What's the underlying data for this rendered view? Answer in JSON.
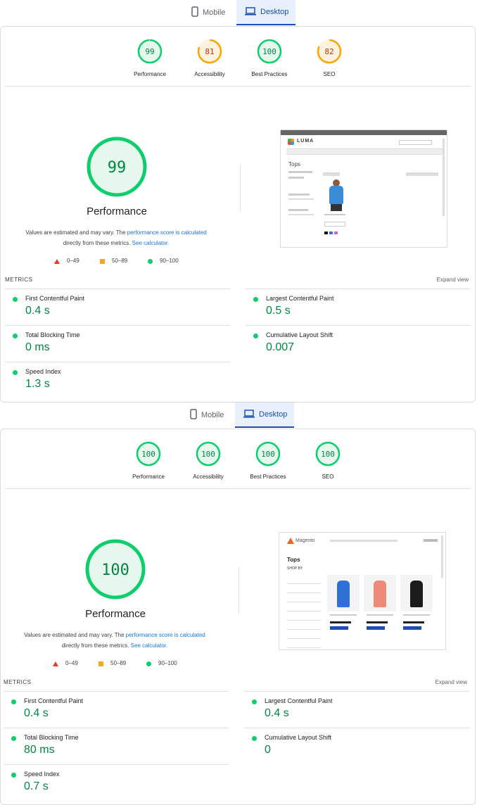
{
  "colors": {
    "pass": "#0cce6b",
    "pass_text": "#018642",
    "pass_fill": "#e6f8ee",
    "average": "#ffa400",
    "average_text": "#c33300",
    "average_fill": "#fff3e0",
    "fail": "#e8382a",
    "link": "#1a73e8"
  },
  "reports": [
    {
      "tabs": {
        "mobile": "Mobile",
        "desktop": "Desktop",
        "active": "desktop"
      },
      "categories": [
        {
          "score": "99",
          "label": "Performance",
          "rating": "pass"
        },
        {
          "score": "81",
          "label": "Accessibility",
          "rating": "average"
        },
        {
          "score": "100",
          "label": "Best Practices",
          "rating": "pass"
        },
        {
          "score": "82",
          "label": "SEO",
          "rating": "average"
        }
      ],
      "main_score": "99",
      "main_title": "Performance",
      "note": {
        "pre": "Values are estimated and may vary. The ",
        "link1": "performance score is calculated",
        "mid": " directly from these metrics. ",
        "link2": "See calculator."
      },
      "legend": {
        "fail": "0–49",
        "average": "50–89",
        "pass": "90–100"
      },
      "thumbnail": {
        "brand": "LUMA",
        "page_title": "Tops"
      },
      "metrics_heading": "METRICS",
      "expand_label": "Expand view",
      "metrics": [
        {
          "name": "First Contentful Paint",
          "value": "0.4 s"
        },
        {
          "name": "Largest Contentful Paint",
          "value": "0.5 s"
        },
        {
          "name": "Total Blocking Time",
          "value": "0 ms"
        },
        {
          "name": "Cumulative Layout Shift",
          "value": "0.007"
        },
        {
          "name": "Speed Index",
          "value": "1.3 s"
        }
      ]
    },
    {
      "tabs": {
        "mobile": "Mobile",
        "desktop": "Desktop",
        "active": "desktop"
      },
      "categories": [
        {
          "score": "100",
          "label": "Performance",
          "rating": "pass"
        },
        {
          "score": "100",
          "label": "Accessibility",
          "rating": "pass"
        },
        {
          "score": "100",
          "label": "Best Practices",
          "rating": "pass"
        },
        {
          "score": "100",
          "label": "SEO",
          "rating": "pass"
        }
      ],
      "main_score": "100",
      "main_title": "Performance",
      "note": {
        "pre": "Values are estimated and may vary. The ",
        "link1": "performance score is calculated",
        "mid": " directly from these metrics. ",
        "link2": "See calculator."
      },
      "legend": {
        "fail": "0–49",
        "average": "50–89",
        "pass": "90–100"
      },
      "thumbnail": {
        "brand": "Magento",
        "page_title": "Tops",
        "shop_by": "SHOP BY"
      },
      "metrics_heading": "METRICS",
      "expand_label": "Expand view",
      "metrics": [
        {
          "name": "First Contentful Paint",
          "value": "0.4 s"
        },
        {
          "name": "Largest Contentful Paint",
          "value": "0.4 s"
        },
        {
          "name": "Total Blocking Time",
          "value": "80 ms"
        },
        {
          "name": "Cumulative Layout Shift",
          "value": "0"
        },
        {
          "name": "Speed Index",
          "value": "0.7 s"
        }
      ]
    }
  ]
}
